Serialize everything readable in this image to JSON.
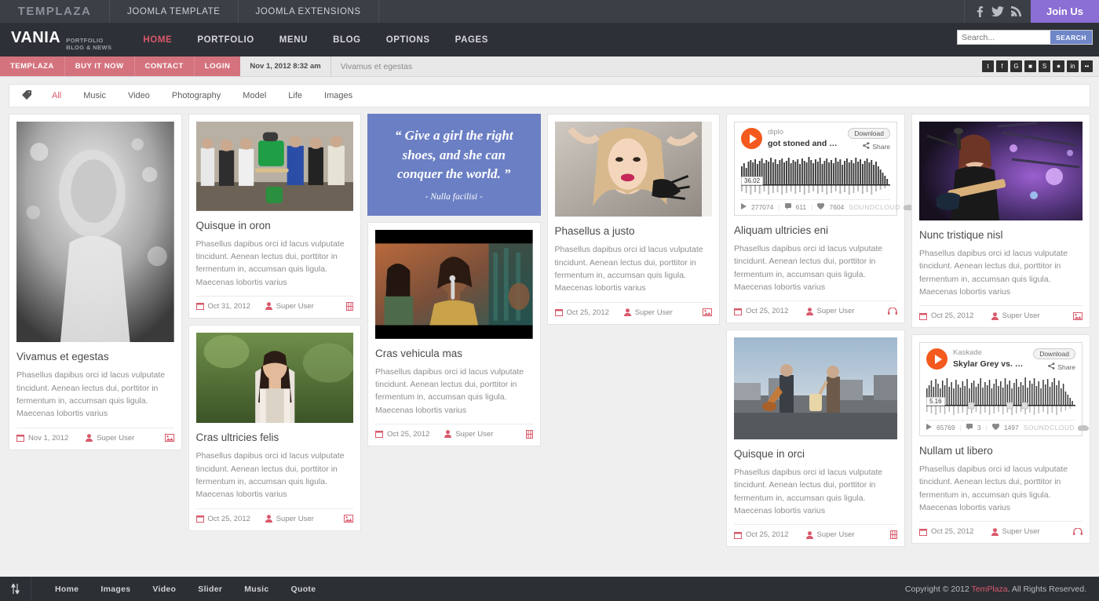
{
  "topbar": {
    "logo": "TEMPLAZA",
    "links": [
      "JOOMLA TEMPLATE",
      "JOOMLA EXTENSIONS"
    ],
    "social": [
      "facebook-icon",
      "twitter-icon",
      "rss-icon"
    ],
    "join_label": "Join Us",
    "join_color": "#8b6fd4"
  },
  "header": {
    "brand_name": "VANIA",
    "brand_sub_line1": "PORTFOLIO",
    "brand_sub_line2": "BLOG & NEWS",
    "nav": [
      {
        "label": "HOME",
        "active": true
      },
      {
        "label": "PORTFOLIO",
        "active": false
      },
      {
        "label": "MENU",
        "active": false
      },
      {
        "label": "BLOG",
        "active": false
      },
      {
        "label": "OPTIONS",
        "active": false
      },
      {
        "label": "PAGES",
        "active": false
      }
    ],
    "search_placeholder": "Search...",
    "search_value": "",
    "search_button": "SEARCH",
    "accent_color": "#d9596b"
  },
  "breadcrumb": {
    "red_links": [
      "TEMPLAZA",
      "BUY IT NOW",
      "CONTACT",
      "LOGIN"
    ],
    "date": "Nov 1, 2012 8:32 am",
    "title": "Vivamus et egestas",
    "social": [
      "twitter-icon",
      "facebook-icon",
      "google-plus-icon",
      "dribbble-icon",
      "skype-icon",
      "rss-icon",
      "linkedin-icon",
      "flickr-icon"
    ],
    "bar_color": "#d4737e"
  },
  "filters": {
    "icon": "tag-icon",
    "items": [
      {
        "label": "All",
        "active": true
      },
      {
        "label": "Music",
        "active": false
      },
      {
        "label": "Video",
        "active": false
      },
      {
        "label": "Photography",
        "active": false
      },
      {
        "label": "Model",
        "active": false
      },
      {
        "label": "Life",
        "active": false
      },
      {
        "label": "Images",
        "active": false
      }
    ]
  },
  "common": {
    "excerpt": "Phasellus dapibus orci id lacus vulputate tincidunt. Aenean lectus dui, porttitor in fermentum in, accumsan quis ligula. Maecenas lobortis varius",
    "author": "Super User"
  },
  "cards": {
    "c1": {
      "title": "Vivamus et egestas",
      "date": "Nov 1, 2012",
      "author": "Super User",
      "type_icon": "image-icon"
    },
    "c2": {
      "title": "Quisque in oron",
      "date": "Oct 31, 2012",
      "author": "Super User",
      "type_icon": "video-icon"
    },
    "c3": {
      "title": "Cras ultricies felis",
      "date": "Oct 25, 2012",
      "author": "Super User",
      "type_icon": "image-icon"
    },
    "c4": {
      "title": "Cras vehicula mas",
      "date": "Oct 25, 2012",
      "author": "Super User",
      "type_icon": "video-icon"
    },
    "c5": {
      "title": "Phasellus a justo",
      "date": "Oct 25, 2012",
      "author": "Super User",
      "type_icon": "image-icon"
    },
    "c6": {
      "title": "Aliquam ultricies eni",
      "date": "Oct 25, 2012",
      "author": "Super User",
      "type_icon": "headphones-icon"
    },
    "c7": {
      "title": "Quisque in orci",
      "date": "Oct 25, 2012",
      "author": "Super User",
      "type_icon": "video-icon"
    },
    "c8": {
      "title": "Nunc tristique nisl",
      "date": "Oct 25, 2012",
      "author": "Super User",
      "type_icon": "image-icon"
    },
    "c9": {
      "title": "Nullam ut libero",
      "date": "Oct 25, 2012",
      "author": "Super User",
      "type_icon": "headphones-icon"
    }
  },
  "quote": {
    "text": "“  Give a girl the right shoes, and she can conquer the world. ”",
    "author": "- Nulla facilisi -",
    "bg_color": "#6b7fc4"
  },
  "soundcloud": [
    {
      "artist": "diplo",
      "track": "got stoned and mixed r...",
      "download_label": "Download",
      "share_label": "Share",
      "time": "36.02",
      "plays": "277074",
      "comments": "611",
      "likes": "7604",
      "brand": "SOUNDCLOUD"
    },
    {
      "artist": "Kaskade",
      "track": "Skylar Grey vs. Thomas...",
      "download_label": "Download",
      "share_label": "Share",
      "time": "5.16",
      "plays": "65769",
      "comments": "3",
      "likes": "1497",
      "brand": "SOUNDCLOUD"
    }
  ],
  "footer": {
    "toggle_icon": "sort-toggle-icon",
    "nav": [
      "Home",
      "Images",
      "Video",
      "Slider",
      "Music",
      "Quote"
    ],
    "copyright_prefix": "Copyright © 2012 ",
    "copyright_brand": "TemPlaza",
    "copyright_suffix": ". All Rights Reserved."
  }
}
